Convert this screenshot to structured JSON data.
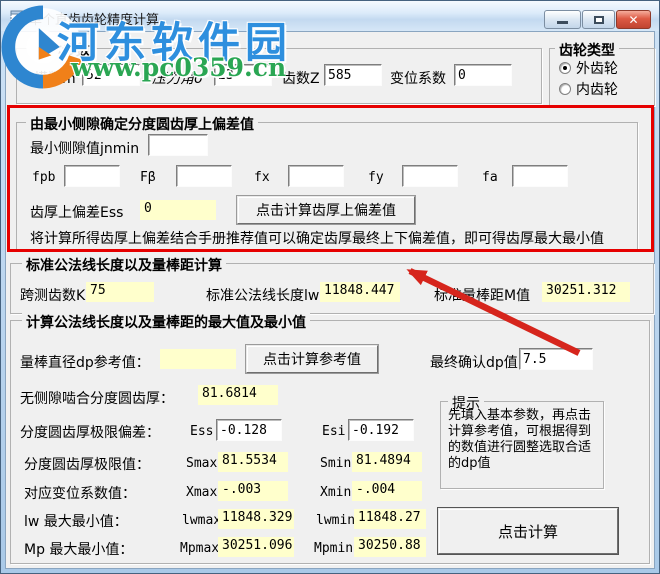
{
  "window": {
    "title": "单个直齿齿轮精度计算"
  },
  "watermark": {
    "site_name": "河东软件园",
    "site_url": "www.pc0359.cn"
  },
  "basic_params": {
    "title": "基本参数",
    "fields": [
      {
        "label": "模数m",
        "value": "52"
      },
      {
        "label": "压力角σ",
        "value": "23"
      },
      {
        "label": "齿数Z",
        "value": "585"
      },
      {
        "label": "变位系数",
        "value": "0"
      }
    ]
  },
  "gear_type": {
    "title": "齿轮类型",
    "options": [
      {
        "label": "外齿轮",
        "selected": true
      },
      {
        "label": "内齿轮",
        "selected": false
      }
    ]
  },
  "backlash_group": {
    "title": "由最小侧隙确定分度圆齿厚上偏差值",
    "jnmin_label": "最小侧隙值jnmin",
    "jnmin_value": "",
    "factors": [
      {
        "label": "fpb",
        "value": ""
      },
      {
        "label": "Fβ",
        "value": ""
      },
      {
        "label": "fx",
        "value": ""
      },
      {
        "label": "fy",
        "value": ""
      },
      {
        "label": "fa",
        "value": ""
      }
    ],
    "ess_label": "齿厚上偏差Ess",
    "ess_value": "0",
    "calc_button": "点击计算齿厚上偏差值",
    "note": "将计算所得齿厚上偏差结合手册推荐值可以确定齿厚最终上下偏差值，即可得齿厚最大最小值"
  },
  "standard_group": {
    "title": "标准公法线长度以及量棒距计算",
    "fields": [
      {
        "label": "跨测齿数K",
        "value": "75"
      },
      {
        "label": "标准公法线长度lw",
        "value": "11848.447"
      },
      {
        "label": "标准量棒距M值",
        "value": "30251.312"
      }
    ]
  },
  "calc_group": {
    "title": "计算公法线长度以及量棒距的最大值及最小值",
    "dp_ref_label": "量棒直径dp参考值：",
    "dp_ref_value": "",
    "calc_ref_button": "点击计算参考值",
    "dp_final_label": "最终确认dp值：",
    "dp_final_value": "7.5",
    "no_backlash": {
      "label": "无侧隙啮合分度圆齿厚：",
      "value": "81.6814"
    },
    "limit_deviation": {
      "label": "分度圆齿厚极限偏差：",
      "max_key": "Ess",
      "max_value": "-0.128",
      "min_key": "Esi",
      "min_value": "-0.192"
    },
    "limit_thickness": {
      "label": "分度圆齿厚极限值：",
      "max_key": "Smax",
      "max_value": "81.5534",
      "min_key": "Smin",
      "min_value": "81.4894"
    },
    "shift_coeff": {
      "label": "对应变位系数值：",
      "max_key": "Xmax",
      "max_value": "-.003",
      "min_key": "Xmin",
      "min_value": "-.004"
    },
    "lw_minmax": {
      "label": "lw 最大最小值：",
      "max_key": "lwmax",
      "max_value": "11848.329",
      "min_key": "lwmin",
      "min_value": "11848.27"
    },
    "mp_minmax": {
      "label": "Mp 最大最小值：",
      "max_key": "Mpmax",
      "max_value": "30251.096",
      "min_key": "Mpmin",
      "min_value": "30250.88"
    },
    "tip": {
      "title": "提示",
      "text": "先填入基本参数，再点击计算参考值，可根据得到的数值进行圆整选取合适的dp值"
    },
    "calc_button": "点击计算"
  },
  "annotations": {
    "highlight_box_color": "#e60000",
    "arrow_color": "#d6251c"
  },
  "colors": {
    "field_highlight": "#ffffcc",
    "watermark_blue": "#2e8fde",
    "watermark_green": "#2aa653"
  }
}
